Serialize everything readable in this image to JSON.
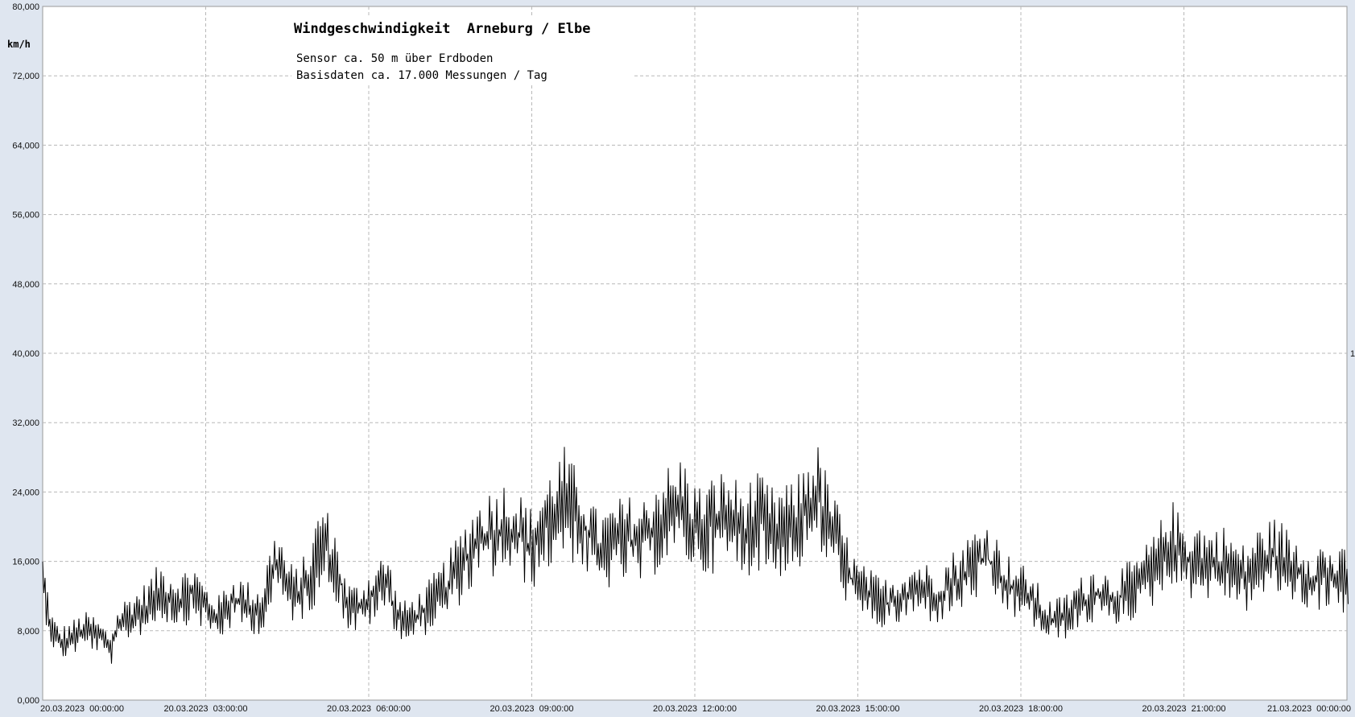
{
  "chart_data": {
    "type": "line",
    "title": "Windgeschwindigkeit  Arneburg / Elbe",
    "subtitle_lines": [
      "Sensor ca. 50 m über Erdboden",
      "Basisdaten ca. 17.000 Messungen / Tag"
    ],
    "ylabel": "km/h",
    "xlabel": "",
    "ylim": [
      0,
      80
    ],
    "y_tick_values": [
      0,
      8,
      16,
      24,
      32,
      40,
      48,
      56,
      64,
      72,
      80
    ],
    "y_tick_labels": [
      "0,000",
      "8,000",
      "16,000",
      "24,000",
      "32,000",
      "40,000",
      "48,000",
      "56,000",
      "64,000",
      "72,000",
      "80,000"
    ],
    "xlim_hours": [
      0,
      24
    ],
    "x_tick_hours": [
      0,
      3,
      6,
      9,
      12,
      15,
      18,
      21,
      24
    ],
    "x_tick_labels": [
      "20.03.2023  00:00:00",
      "20.03.2023  03:00:00",
      "20.03.2023  06:00:00",
      "20.03.2023  09:00:00",
      "20.03.2023  12:00:00",
      "20.03.2023  15:00:00",
      "20.03.2023  18:00:00",
      "20.03.2023  21:00:00",
      "21.03.2023  00:00:00"
    ],
    "right_axis_label": "1",
    "grid": true,
    "colors": {
      "line": "#000000",
      "grid": "#b8b8b8",
      "plot_bg": "#ffffff",
      "frame_bg": "#dfe6f0"
    },
    "series": [
      {
        "values": [
          13.5,
          8.2,
          6.5,
          7.0,
          7.5,
          8.0,
          7.8,
          7.0,
          6.0,
          8.5,
          9.5,
          10.0,
          10.5,
          11.5,
          12.5,
          12.0,
          11.5,
          12.0,
          12.5,
          11.0,
          10.0,
          9.5,
          11.0,
          11.5,
          11.0,
          10.5,
          10.5,
          14.0,
          16.0,
          13.0,
          12.0,
          13.0,
          14.5,
          18.5,
          17.0,
          15.0,
          11.0,
          10.5,
          11.0,
          12.0,
          13.0,
          13.5,
          10.0,
          9.0,
          9.5,
          10.0,
          11.0,
          12.0,
          13.0,
          14.5,
          16.0,
          17.5,
          18.5,
          19.0,
          19.5,
          20.0,
          19.5,
          18.5,
          17.5,
          19.0,
          20.5,
          22.0,
          23.0,
          21.5,
          20.5,
          18.5,
          17.0,
          17.5,
          18.0,
          18.5,
          18.5,
          18.0,
          19.0,
          20.5,
          21.5,
          21.0,
          22.5,
          20.5,
          19.5,
          20.0,
          20.5,
          21.0,
          20.5,
          19.5,
          20.0,
          20.5,
          20.0,
          19.0,
          20.0,
          19.5,
          21.0,
          22.5,
          23.5,
          21.0,
          19.0,
          16.5,
          14.0,
          12.5,
          12.0,
          11.5,
          11.0,
          11.5,
          12.0,
          12.5,
          13.0,
          12.5,
          12.0,
          12.5,
          13.5,
          14.0,
          15.0,
          16.0,
          16.5,
          15.5,
          14.0,
          13.0,
          12.5,
          12.0,
          11.0,
          9.5,
          9.0,
          9.5,
          10.0,
          11.0,
          11.5,
          12.5,
          12.0,
          11.5,
          12.0,
          12.5,
          13.0,
          14.0,
          15.0,
          16.5,
          18.5,
          17.0,
          16.0,
          16.5,
          16.0,
          15.5,
          16.0,
          15.5,
          14.5,
          14.0,
          15.5,
          16.0,
          16.5,
          16.5,
          15.5,
          15.0,
          14.5,
          14.0,
          14.5,
          14.0,
          13.5,
          14.0
        ]
      }
    ]
  }
}
